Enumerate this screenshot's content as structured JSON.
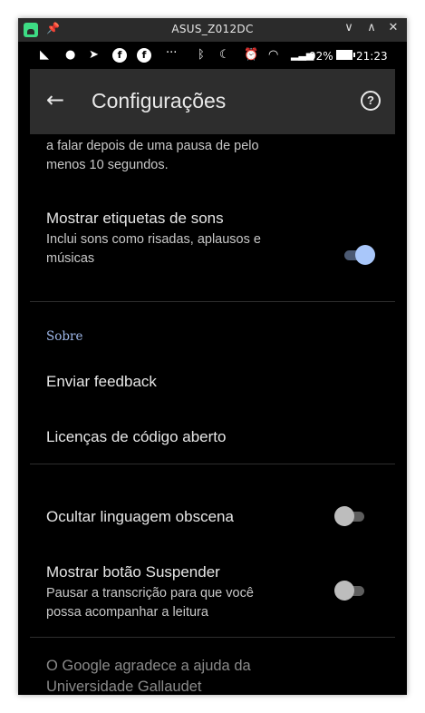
{
  "window": {
    "title": "ASUS_Z012DC"
  },
  "statusbar": {
    "battery": "92%",
    "time": "21:23",
    "overflow": "···"
  },
  "appbar": {
    "title": "Configurações"
  },
  "settings": {
    "partial_text": "a falar depois de uma pausa de pelo menos 10 segundos.",
    "sound_labels": {
      "title": "Mostrar etiquetas de sons",
      "subtitle": "Inclui sons como risadas, aplausos e músicas",
      "enabled": true
    },
    "about_header": "Sobre",
    "feedback": "Enviar feedback",
    "licenses": "Licenças de código aberto",
    "profanity": {
      "title": "Ocultar linguagem obscena",
      "enabled": false
    },
    "pause_button": {
      "title": "Mostrar botão Suspender",
      "subtitle": "Pausar a transcrição para que você possa acompanhar a leitura",
      "enabled": false
    },
    "thanks": "O Google agradece a ajuda da Universidade Gallaudet"
  },
  "colors": {
    "accent": "#a9c7fa",
    "appbar": "#2d2d2d",
    "background": "#000000"
  }
}
